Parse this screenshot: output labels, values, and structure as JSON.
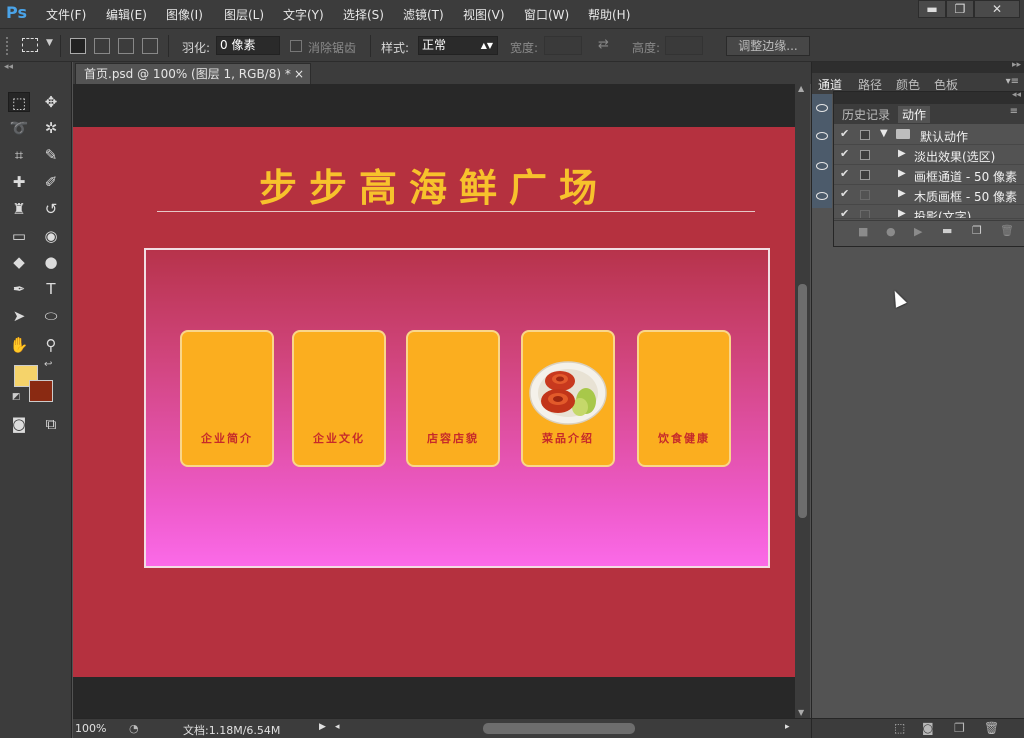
{
  "app": {
    "logo": "Ps"
  },
  "menu": [
    "文件(F)",
    "编辑(E)",
    "图像(I)",
    "图层(L)",
    "文字(Y)",
    "选择(S)",
    "滤镜(T)",
    "视图(V)",
    "窗口(W)",
    "帮助(H)"
  ],
  "window_controls": {
    "minimize": "▬",
    "restore": "❐",
    "close": "✕"
  },
  "options": {
    "feather_label": "羽化:",
    "feather_value": "0 像素",
    "antialias_label": "消除锯齿",
    "style_label": "样式:",
    "style_value": "正常",
    "width_label": "宽度:",
    "height_label": "高度:",
    "refine_edge": "调整边缘..."
  },
  "document": {
    "tab_title": "首页.psd @ 100% (图层 1, RGB/8) *",
    "tab_close": "×"
  },
  "canvas": {
    "title": "步步高海鲜广场",
    "cards": [
      {
        "label": "企业简介",
        "has_image": false
      },
      {
        "label": "企业文化",
        "has_image": false
      },
      {
        "label": "店容店貌",
        "has_image": false
      },
      {
        "label": "菜品介绍",
        "has_image": true
      },
      {
        "label": "饮食健康",
        "has_image": false
      }
    ],
    "colors": {
      "background": "#b5313f",
      "title": "#f7c22c",
      "card": "#fbae1f",
      "card_text": "#c62a2a"
    }
  },
  "status": {
    "zoom": "100%",
    "doc_info": "文档:1.18M/6.54M"
  },
  "panels": {
    "dock_tabs": [
      "通道",
      "路径",
      "颜色",
      "色板"
    ],
    "float_tabs": [
      "历史记录",
      "动作"
    ],
    "actions": [
      {
        "label": "默认动作",
        "checked": true,
        "folder": true,
        "expanded": true
      },
      {
        "label": "淡出效果(选区)",
        "checked": true
      },
      {
        "label": "画框通道 - 50 像素",
        "checked": true
      },
      {
        "label": "木质画框 - 50 像素",
        "checked": true
      },
      {
        "label": "投影(文字)",
        "checked": true
      }
    ]
  }
}
